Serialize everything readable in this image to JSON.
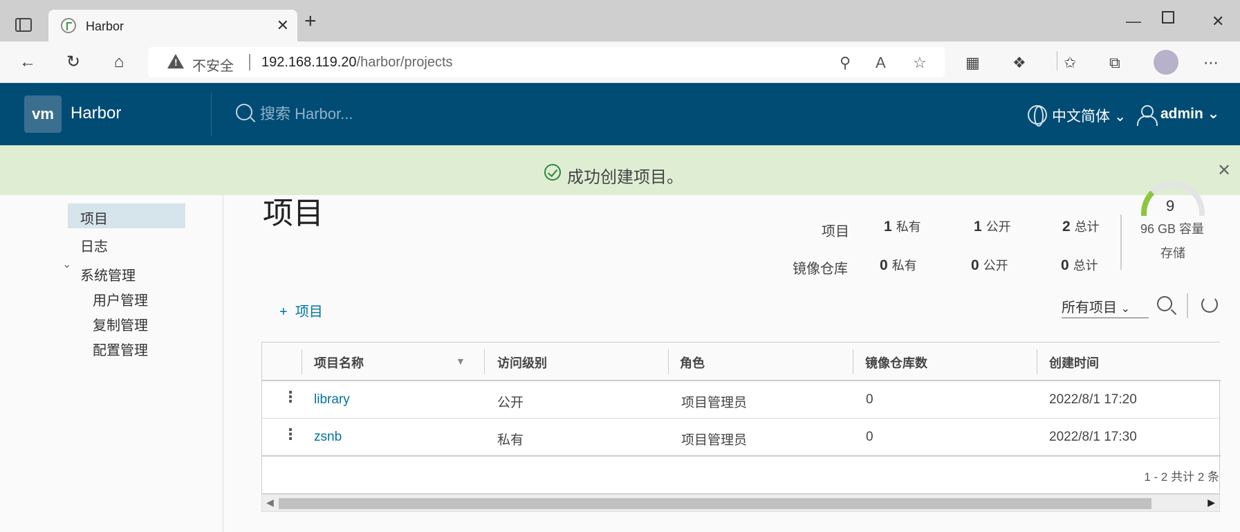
{
  "browser": {
    "tab_title": "Harbor",
    "tab_close": "✕",
    "new_tab": "+",
    "url_insecure": "不安全",
    "url_host": "192.168.119.20",
    "url_path": "/harbor/projects",
    "icons": [
      "back-icon",
      "refresh-icon",
      "home-icon",
      "key-icon",
      "read-aloud-icon",
      "favorite-add-icon",
      "extension-icon",
      "puzzle-icon",
      "favorites-icon",
      "collections-icon",
      "profile-icon",
      "more-icon"
    ]
  },
  "header": {
    "logo": "vm",
    "brand": "Harbor",
    "search_placeholder": "搜索 Harbor...",
    "language": "中文简体",
    "user": "admin",
    "bg_color": "#004c75"
  },
  "alert": {
    "text": "成功创建项目。",
    "bg_color": "#dfeed3"
  },
  "sidebar": {
    "items": [
      {
        "label": "项目"
      },
      {
        "label": "日志"
      },
      {
        "label": "系统管理"
      },
      {
        "label": "用户管理"
      },
      {
        "label": "复制管理"
      },
      {
        "label": "配置管理"
      }
    ]
  },
  "main": {
    "title": "项目",
    "stats": {
      "projects_label": "项目",
      "repos_label": "镜像仓库",
      "private_label": "私有",
      "public_label": "公开",
      "total_label": "总计",
      "projects": {
        "private": "1",
        "public": "1",
        "total": "2"
      },
      "repos": {
        "private": "0",
        "public": "0",
        "total": "0"
      }
    },
    "quota": {
      "count": "9",
      "capacity": "96 GB 容量",
      "storage_label": "存储"
    },
    "add_project": "项目",
    "filter_value": "所有项目",
    "table": {
      "columns": [
        "项目名称",
        "访问级别",
        "角色",
        "镜像仓库数",
        "创建时间"
      ],
      "rows": [
        {
          "name": "library",
          "access": "公开",
          "role": "项目管理员",
          "repos": "0",
          "created": "2022/8/1 17:20"
        },
        {
          "name": "zsnb",
          "access": "私有",
          "role": "项目管理员",
          "repos": "0",
          "created": "2022/8/1 17:30"
        }
      ],
      "pagination": "1 - 2 共计 2 条"
    }
  }
}
